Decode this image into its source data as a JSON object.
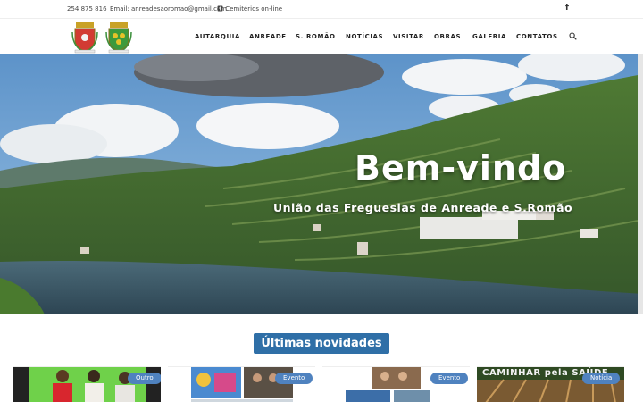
{
  "topbar": {
    "phone": "254 875 816",
    "email": "Email: anreadesaoromao@gmail.com",
    "cemeteries": "Cemitérios on-line",
    "facebook_glyph": "f"
  },
  "nav": {
    "items": [
      "AUTARQUIA",
      "ANREADE",
      "S. ROMÃO",
      "NOTÍCIAS",
      "VISITAR",
      "OBRAS",
      "GALERIA",
      "CONTATOS"
    ]
  },
  "hero": {
    "title": "Bem-vindo",
    "subtitle": "União das Freguesias de Anreade e S.Romão"
  },
  "news": {
    "title": "Últimas novidades",
    "cards": [
      {
        "badge": "Outro"
      },
      {
        "badge": "Evento"
      },
      {
        "badge": "Evento"
      },
      {
        "badge": "Notícia",
        "image_text": "CAMINHAR pela SAÚDE"
      }
    ]
  },
  "colors": {
    "accent": "#2f6fa7",
    "badge": "#4f82bf"
  },
  "icons": [
    "facebook-icon",
    "cemetery-icon",
    "search-icon",
    "crest-icon"
  ]
}
